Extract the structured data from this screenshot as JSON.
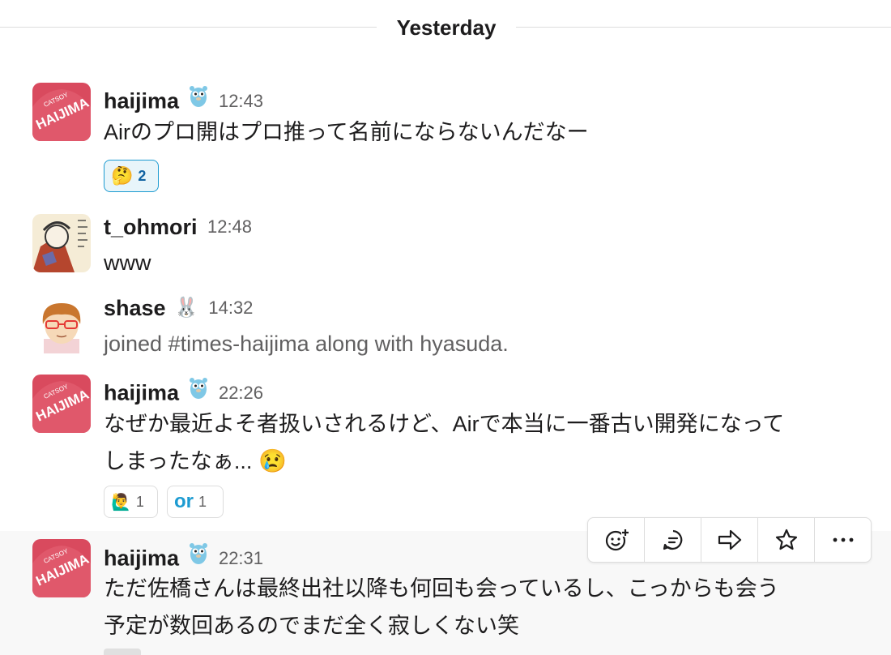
{
  "divider": {
    "label": "Yesterday"
  },
  "messages": [
    {
      "user": "haijima",
      "time": "12:43",
      "text": "Airのプロ開はプロ推って名前にならないんだなー",
      "reactions": [
        {
          "emoji": "🤔",
          "count": "2"
        }
      ]
    },
    {
      "user": "t_ohmori",
      "time": "12:48",
      "text": "www"
    },
    {
      "user": "shase",
      "status": "🐰",
      "time": "14:32",
      "text": "joined #times-haijima along with hyasuda."
    },
    {
      "user": "haijima",
      "time": "22:26",
      "line1": "なぜか最近よそ者扱いされるけど、Airで本当に一番古い開発になって",
      "line2": "しまったなぁ...",
      "emoji": "😢",
      "reactions": [
        {
          "emoji": "🙋‍♂️",
          "count": "1"
        },
        {
          "emoji": "or",
          "count": "1"
        }
      ]
    },
    {
      "user": "haijima",
      "time": "22:31",
      "line1": "ただ佐橋さんは最終出社以降も何回も会っているし、こっからも会う",
      "line2": "予定が数回あるのでまだ全く寂しくない笑"
    }
  ],
  "avatar_text": {
    "brand": "CATSOY",
    "name": "HAIJIMA"
  },
  "toolbar_icons": [
    "add-reaction-icon",
    "reply-thread-icon",
    "share-icon",
    "star-icon",
    "more-icon"
  ],
  "colors": {
    "accent": "#1264a3",
    "reaction_bg": "#e8f5fa",
    "avatar_red": "#d94a5e"
  }
}
